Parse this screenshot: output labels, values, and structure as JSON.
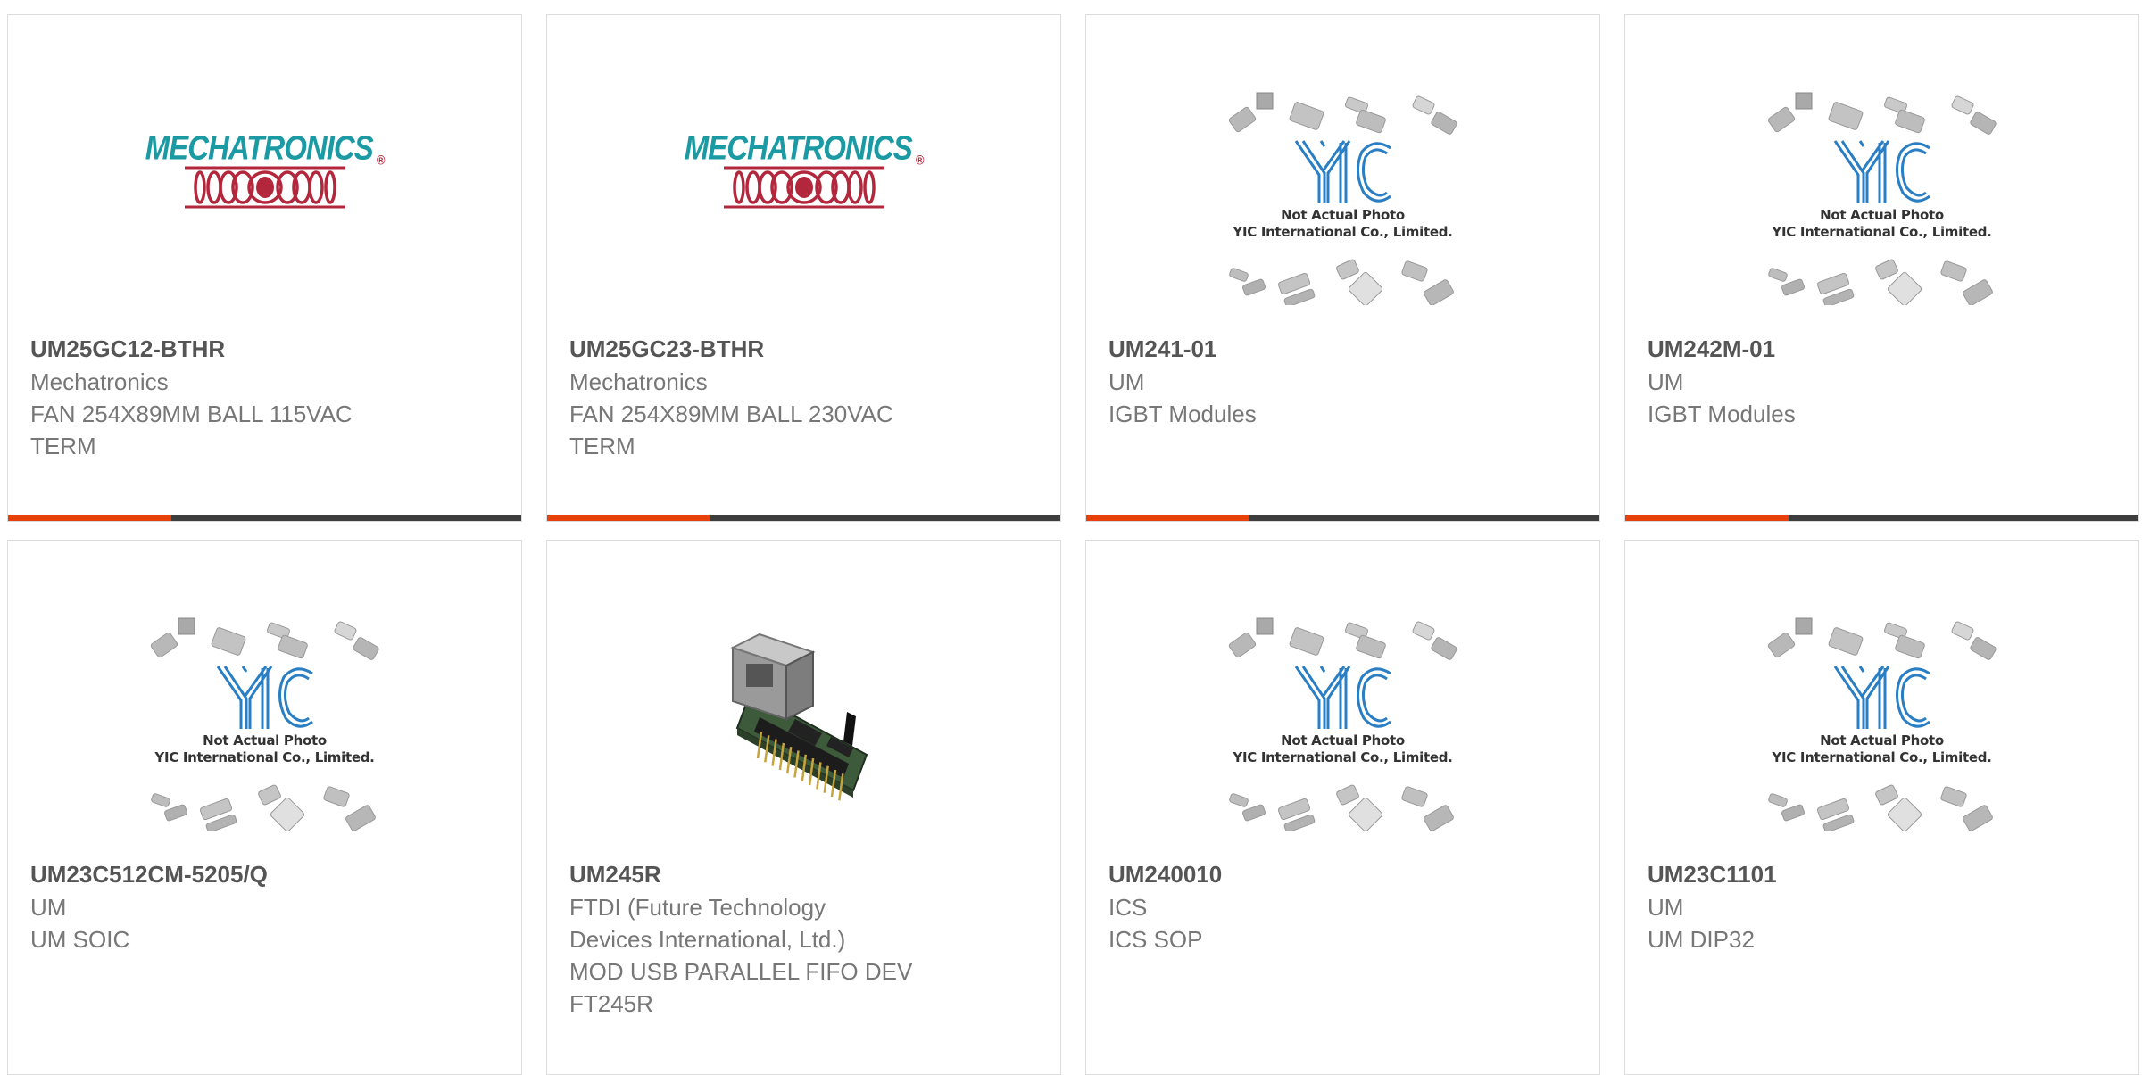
{
  "products": [
    {
      "part": "UM25GC12-BTHR",
      "lines": [
        "Mechatronics",
        "FAN 254X89MM BALL 115VAC",
        "TERM"
      ],
      "image": "mechatronics-logo",
      "logo_text": "MECHATRONICS",
      "logo_mark": "®",
      "accent_bar": true
    },
    {
      "part": "UM25GC23-BTHR",
      "lines": [
        "Mechatronics",
        "FAN 254X89MM BALL 230VAC",
        "TERM"
      ],
      "image": "mechatronics-logo",
      "logo_text": "MECHATRONICS",
      "logo_mark": "®",
      "accent_bar": true
    },
    {
      "part": "UM241-01",
      "lines": [
        "UM",
        "IGBT Modules"
      ],
      "image": "yic-placeholder",
      "note_line1": "Not Actual Photo",
      "note_line2": "YIC International Co., Limited.",
      "accent_bar": true
    },
    {
      "part": "UM242M-01",
      "lines": [
        "UM",
        "IGBT Modules"
      ],
      "image": "yic-placeholder",
      "note_line1": "Not Actual Photo",
      "note_line2": "YIC International Co., Limited.",
      "accent_bar": true
    },
    {
      "part": "UM23C512CM-5205/Q",
      "lines": [
        "UM",
        "UM SOIC"
      ],
      "image": "yic-placeholder",
      "note_line1": "Not Actual Photo",
      "note_line2": "YIC International Co., Limited.",
      "accent_bar": false
    },
    {
      "part": "UM245R",
      "lines": [
        "FTDI (Future Technology",
        "Devices International, Ltd.)",
        "MOD USB PARALLEL FIFO DEV",
        "FT245R"
      ],
      "image": "usb-module-photo",
      "accent_bar": false
    },
    {
      "part": "UM240010",
      "lines": [
        "ICS",
        "ICS SOP"
      ],
      "image": "yic-placeholder",
      "note_line1": "Not Actual Photo",
      "note_line2": "YIC International Co., Limited.",
      "accent_bar": false
    },
    {
      "part": "UM23C1101",
      "lines": [
        "UM",
        "UM DIP32"
      ],
      "image": "yic-placeholder",
      "note_line1": "Not Actual Photo",
      "note_line2": "YIC International Co., Limited.",
      "accent_bar": false
    }
  ],
  "colors": {
    "accent": "#e8400c",
    "bar": "#3d3d3d",
    "part_text": "#555555",
    "line_text": "#777777",
    "mech_teal": "#1b9aa4",
    "mech_red": "#b3273c",
    "yic_blue": "#2a7fc4",
    "chip_gray": "#b8b8b8"
  }
}
